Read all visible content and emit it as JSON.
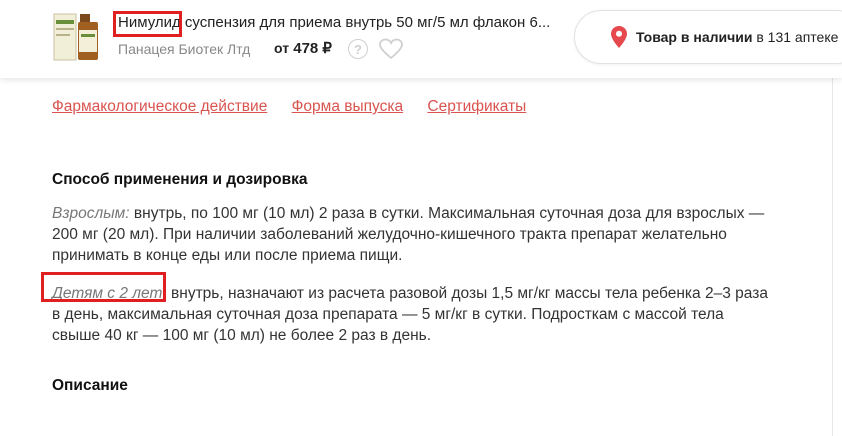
{
  "header": {
    "product_brand": "Нимулид",
    "product_rest": " суспензия для приема внутрь 50 мг/5 мл флакон 6...",
    "manufacturer": "Панацея Биотек Лтд",
    "price_prefix": "от",
    "price_value": "478 ₽",
    "stock_prefix": "Товар в наличии",
    "stock_suffix": " в 131 аптеке"
  },
  "tabs": [
    {
      "label": "Фармакологическое действие"
    },
    {
      "label": "Форма выпуска"
    },
    {
      "label": "Сертификаты"
    }
  ],
  "dosage": {
    "title": "Способ применения и дозировка",
    "adults_label": "Взрослым:",
    "adults_text": " внутрь, по 100 мг (10 мл) 2 раза в сутки. Максимальная суточная доза для взрослых — 200 мг (20 мл). При наличии заболеваний желудочно-кишечного тракта препарат желательно принимать в конце еды или после приема пищи.",
    "children_label": "Детям с 2 лет",
    "children_text": ": внутрь, назначают из расчета разовой дозы 1,5 мг/кг массы тела ребенка 2–3 раза в день, максимальная суточная доза препарата — 5 мг/кг в сутки. Подросткам с массой тела свыше 40 кг — 100 мг (10 мл) не более 2 раз в день."
  },
  "description": {
    "title": "Описание"
  },
  "colors": {
    "accent_red": "#d9534f",
    "highlight_box": "#e02020"
  },
  "icons": [
    "product-thumbnail",
    "help-icon",
    "heart-icon",
    "location-pin-icon"
  ]
}
